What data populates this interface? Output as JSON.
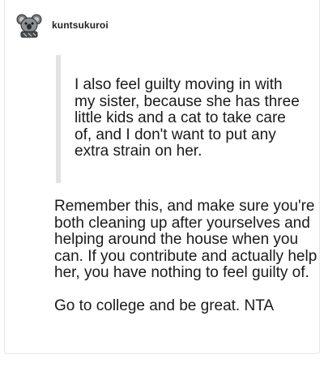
{
  "post": {
    "username": "kuntsukuroi",
    "avatar_icon": "koala-avatar-icon",
    "quote_text": "I also feel guilty moving in with my sister, because she has three little kids and a cat to take care of, and I don't want to put any extra strain on her.",
    "reply_paragraphs": [
      "Remember this, and make sure you're both cleaning up after yourselves and helping around the house when you can. If you contribute and actually help her, you have nothing to feel guilty of.",
      "Go to college and be great. NTA"
    ]
  },
  "colors": {
    "text": "#1a1a1a",
    "quote_bar": "#e3e3e3",
    "border": "#e6e6e6"
  }
}
